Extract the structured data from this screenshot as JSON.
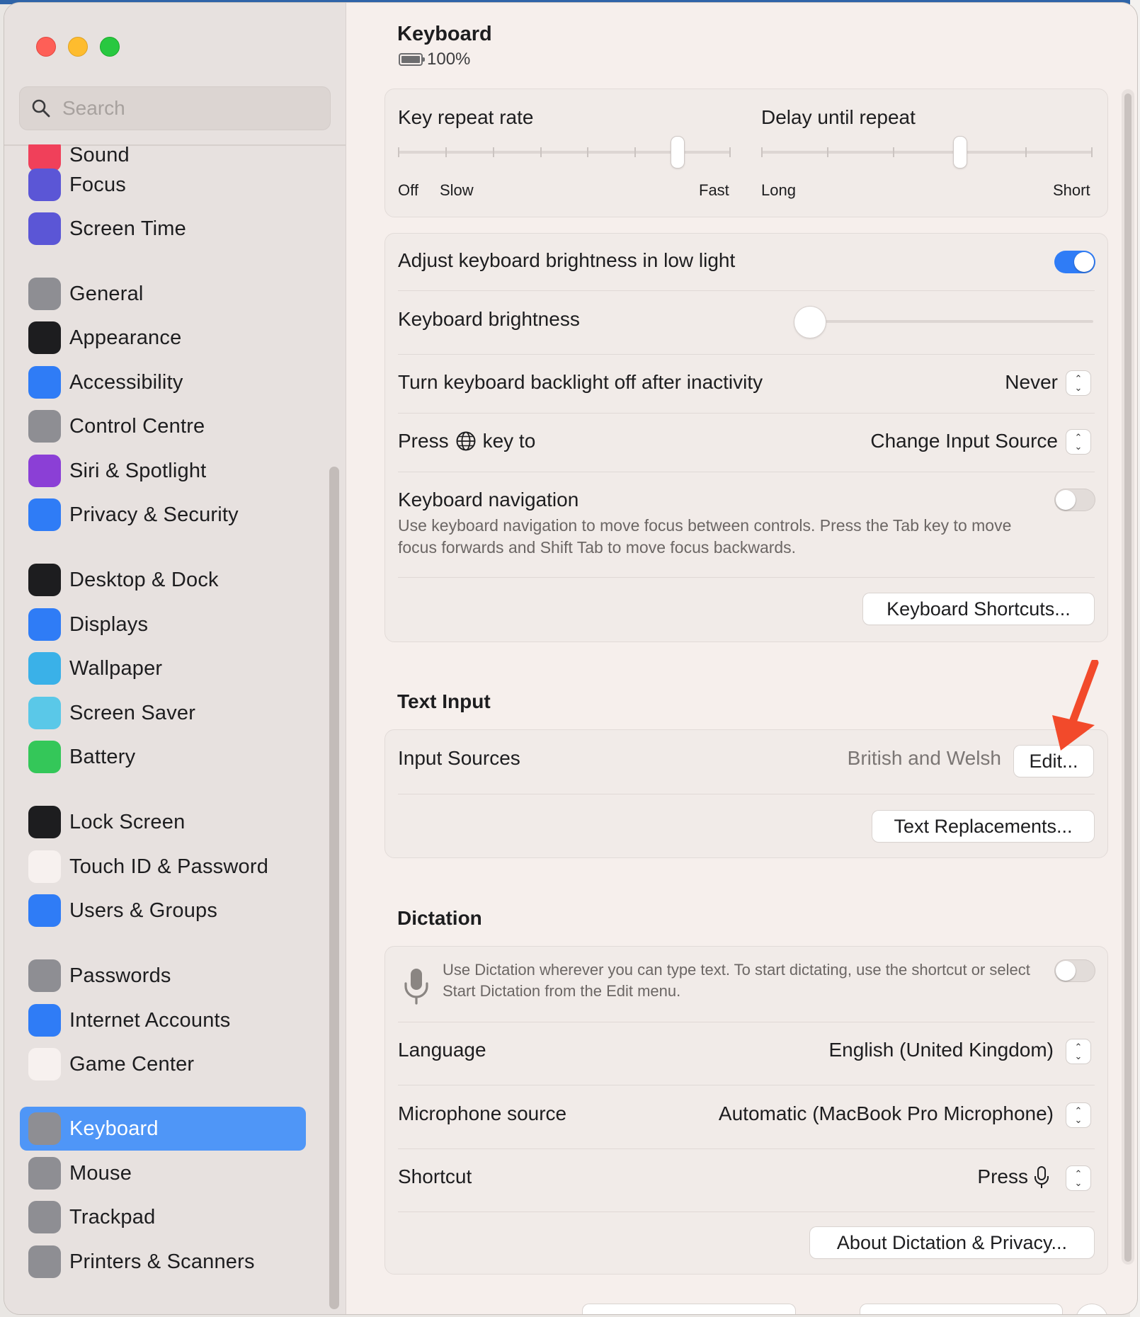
{
  "sidebar": {
    "search_placeholder": "Search",
    "items": [
      {
        "label": "Sound",
        "icon": "speaker-icon",
        "color": "#f0405a"
      },
      {
        "label": "Focus",
        "icon": "moon-icon",
        "color": "#5b56d6"
      },
      {
        "label": "Screen Time",
        "icon": "hourglass-icon",
        "color": "#5b56d6"
      },
      {
        "label": "General",
        "icon": "gear-icon",
        "color": "#8e8e93"
      },
      {
        "label": "Appearance",
        "icon": "appearance-icon",
        "color": "#1d1d1f"
      },
      {
        "label": "Accessibility",
        "icon": "accessibility-icon",
        "color": "#2f7cf6"
      },
      {
        "label": "Control Centre",
        "icon": "toggles-icon",
        "color": "#8e8e93"
      },
      {
        "label": "Siri & Spotlight",
        "icon": "siri-icon",
        "color": "#8b3fd6"
      },
      {
        "label": "Privacy & Security",
        "icon": "hand-icon",
        "color": "#2f7cf6"
      },
      {
        "label": "Desktop & Dock",
        "icon": "dock-icon",
        "color": "#1d1d1f"
      },
      {
        "label": "Displays",
        "icon": "sun-icon",
        "color": "#2f7cf6"
      },
      {
        "label": "Wallpaper",
        "icon": "flower-icon",
        "color": "#3ab1e8"
      },
      {
        "label": "Screen Saver",
        "icon": "screensaver-icon",
        "color": "#5ac8e8"
      },
      {
        "label": "Battery",
        "icon": "battery-icon",
        "color": "#34c759"
      },
      {
        "label": "Lock Screen",
        "icon": "lock-icon",
        "color": "#1d1d1f"
      },
      {
        "label": "Touch ID & Password",
        "icon": "fingerprint-icon",
        "color": "#f7f1ef"
      },
      {
        "label": "Users & Groups",
        "icon": "users-icon",
        "color": "#2f7cf6"
      },
      {
        "label": "Passwords",
        "icon": "key-icon",
        "color": "#8e8e93"
      },
      {
        "label": "Internet Accounts",
        "icon": "at-icon",
        "color": "#2f7cf6"
      },
      {
        "label": "Game Center",
        "icon": "gamecenter-icon",
        "color": "#f7f1ef"
      },
      {
        "label": "Keyboard",
        "icon": "keyboard-icon",
        "color": "#8e8e93",
        "active": true
      },
      {
        "label": "Mouse",
        "icon": "mouse-icon",
        "color": "#8e8e93"
      },
      {
        "label": "Trackpad",
        "icon": "trackpad-icon",
        "color": "#8e8e93"
      },
      {
        "label": "Printers & Scanners",
        "icon": "printer-icon",
        "color": "#8e8e93"
      }
    ]
  },
  "header": {
    "title": "Keyboard",
    "battery_level": "100%"
  },
  "repeat": {
    "key_repeat_label": "Key repeat rate",
    "delay_label": "Delay until repeat",
    "key_repeat_ticks": [
      "Off",
      "Slow",
      "Fast"
    ],
    "delay_ticks": [
      "Long",
      "Short"
    ],
    "key_repeat_value_fraction": 0.84,
    "delay_value_fraction": 0.6
  },
  "brightness": {
    "adjust_label": "Adjust keyboard brightness in low light",
    "adjust_on": true,
    "level_label": "Keyboard brightness",
    "level_fraction": 0.0,
    "backlight_label": "Turn keyboard backlight off after inactivity",
    "backlight_value": "Never",
    "press_label_prefix": "Press",
    "press_label_suffix": "key to",
    "press_value": "Change Input Source",
    "nav_label": "Keyboard navigation",
    "nav_on": false,
    "nav_desc": "Use keyboard navigation to move focus between controls. Press the Tab key to move focus forwards and Shift Tab to move focus backwards.",
    "shortcuts_button": "Keyboard Shortcuts..."
  },
  "text_input": {
    "section_title": "Text Input",
    "input_sources_label": "Input Sources",
    "input_sources_value": "British and Welsh",
    "edit_button": "Edit...",
    "replacements_button": "Text Replacements..."
  },
  "dictation": {
    "section_title": "Dictation",
    "desc": "Use Dictation wherever you can type text. To start dictating, use the shortcut or select Start Dictation from the Edit menu.",
    "enabled": false,
    "language_label": "Language",
    "language_value": "English (United Kingdom)",
    "mic_label": "Microphone source",
    "mic_value": "Automatic (MacBook Pro Microphone)",
    "shortcut_label": "Shortcut",
    "shortcut_value": "Press",
    "about_button": "About Dictation & Privacy..."
  },
  "colors": {
    "accent": "#2f7cf6",
    "sidebar_selected": "#4f96f7",
    "annotation_arrow": "#f24a2b"
  }
}
